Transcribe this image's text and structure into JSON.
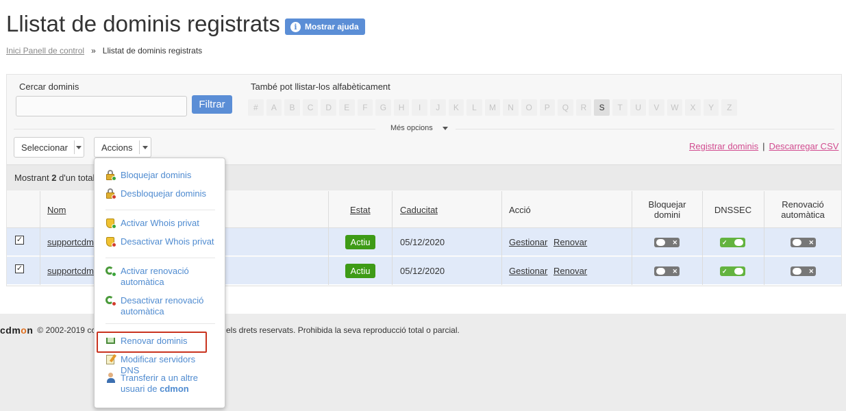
{
  "header": {
    "title": "Llistat de dominis registrats",
    "help_button": "Mostrar ajuda",
    "help_icon": "info-icon"
  },
  "breadcrumb": {
    "home": "Inici Panell de control",
    "separator": "»",
    "current": "Llistat de dominis registrats"
  },
  "search": {
    "label": "Cercar dominis",
    "value": "",
    "filter_button": "Filtrar"
  },
  "alphabet": {
    "label": "També pot llistar-los alfabèticament",
    "letters": [
      "#",
      "A",
      "B",
      "C",
      "D",
      "E",
      "F",
      "G",
      "H",
      "I",
      "J",
      "K",
      "L",
      "M",
      "N",
      "O",
      "P",
      "Q",
      "R",
      "S",
      "T",
      "U",
      "V",
      "W",
      "X",
      "Y",
      "Z"
    ],
    "active": "S"
  },
  "more_options": "Més opcions",
  "toolbar": {
    "select_label": "Seleccionar",
    "actions_label": "Accions",
    "register_link": "Registrar dominis",
    "link_separator": "|",
    "csv_link": "Descarregar CSV"
  },
  "count": {
    "prefix": "Mostrant",
    "number": "2",
    "suffix": "d'un total"
  },
  "table": {
    "headers": {
      "name": "Nom",
      "status": "Estat",
      "expiry": "Caducitat",
      "action": "Acció",
      "lock": "Bloquejar domini",
      "dnssec": "DNSSEC",
      "autorenew": "Renovació automàtica"
    },
    "rows": [
      {
        "checked": true,
        "name": "supportcdm",
        "status": "Actiu",
        "expiry": "05/12/2020",
        "manage": "Gestionar",
        "renew": "Renovar",
        "lock": false,
        "dnssec": true,
        "autorenew": false
      },
      {
        "checked": true,
        "name": "supportcdm",
        "status": "Actiu",
        "expiry": "05/12/2020",
        "manage": "Gestionar",
        "renew": "Renovar",
        "lock": false,
        "dnssec": true,
        "autorenew": false
      }
    ]
  },
  "actions_menu": {
    "items": [
      {
        "label": "Bloquejar dominis",
        "icon": "lock-add-icon"
      },
      {
        "label": "Desbloquejar dominis",
        "icon": "lock-remove-icon"
      },
      {
        "label": "Activar Whois privat",
        "icon": "shield-add-icon"
      },
      {
        "label": "Desactivar Whois privat",
        "icon": "shield-remove-icon"
      },
      {
        "label": "Activar renovació automàtica",
        "icon": "refresh-add-icon"
      },
      {
        "label": "Desactivar renovació automàtica",
        "icon": "refresh-remove-icon"
      },
      {
        "label": "Renovar dominis",
        "icon": "cart-icon"
      },
      {
        "label": "Modificar servidors DNS",
        "icon": "edit-note-icon"
      },
      {
        "label_prefix": "Transferir a un altre usuari de",
        "label_bold": "cdmon",
        "icon": "user-transfer-icon"
      }
    ],
    "highlighted": "Renovar dominis"
  },
  "footer": {
    "logo_prefix": "cdm",
    "logo_o": "o",
    "logo_suffix": "n",
    "copyright_start": "© 2002-2019 cc",
    "copyright_end": "ts els drets reservats. Prohibida la seva reproducció total o parcial."
  },
  "colors": {
    "accent_blue": "#5b8ed6",
    "link_pink": "#d14b8f",
    "status_green": "#3e9b16",
    "highlight_red": "#c9321e",
    "row_blue": "#e1eaf9"
  }
}
